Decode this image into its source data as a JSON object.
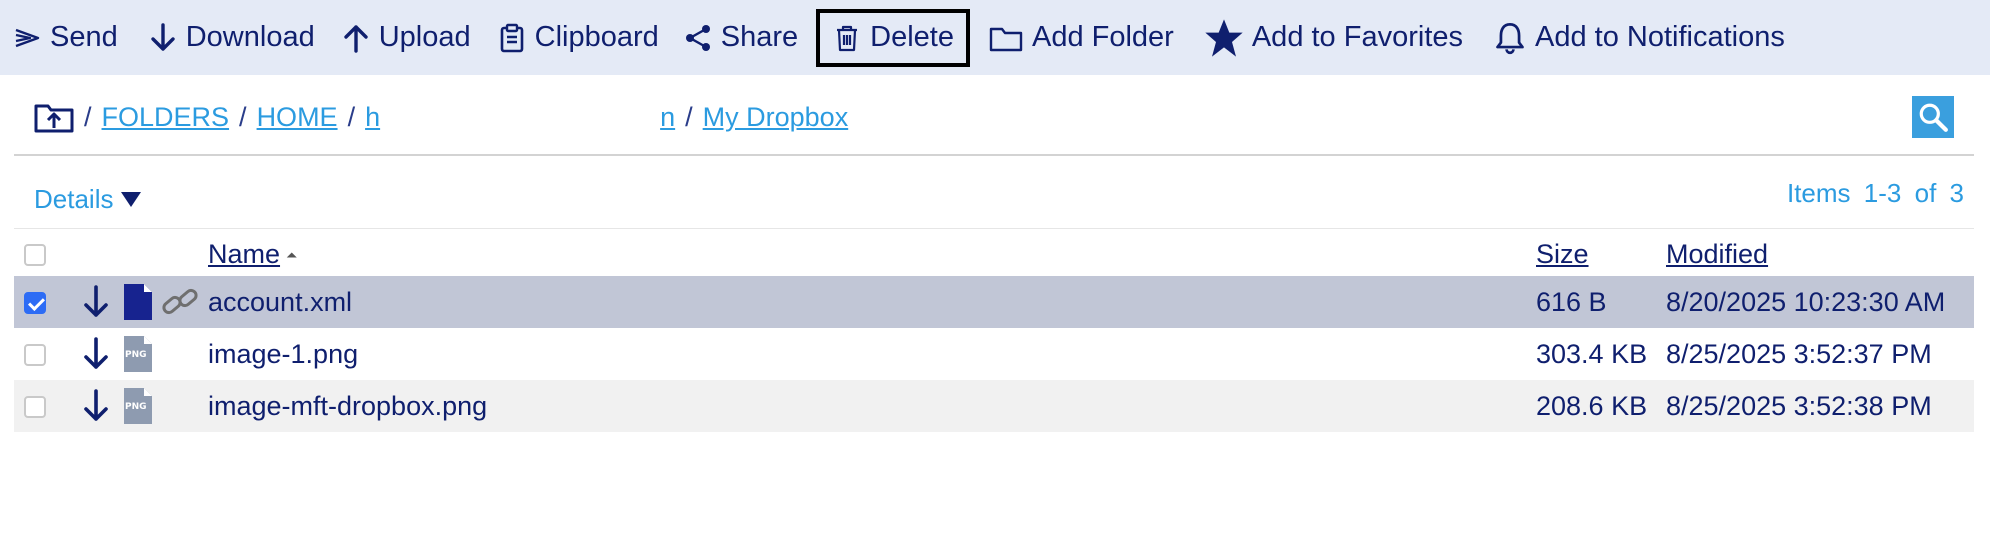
{
  "toolbar": {
    "send": "Send",
    "download": "Download",
    "upload": "Upload",
    "clipboard": "Clipboard",
    "share": "Share",
    "delete": "Delete",
    "add_folder": "Add Folder",
    "add_favorites": "Add to Favorites",
    "add_notifications": "Add to Notifications"
  },
  "breadcrumb": {
    "sep": "/",
    "items": [
      "FOLDERS",
      "HOME",
      "h",
      "n",
      "My Dropbox"
    ]
  },
  "view": {
    "details_label": "Details",
    "items_label": "Items",
    "items_range": "1-3",
    "items_of": "of",
    "items_total": "3"
  },
  "table": {
    "headers": {
      "name": "Name",
      "size": "Size",
      "modified": "Modified"
    },
    "rows": [
      {
        "name": "account.xml",
        "size": "616 B",
        "modified": "8/20/2025 10:23:30 AM",
        "checked": true,
        "icon": "xml-file-icon"
      },
      {
        "name": "image-1.png",
        "size": "303.4 KB",
        "modified": "8/25/2025 3:52:37 PM",
        "checked": false,
        "icon": "png-file-icon",
        "badge": "PNG"
      },
      {
        "name": "image-mft-dropbox.png",
        "size": "208.6 KB",
        "modified": "8/25/2025 3:52:38 PM",
        "checked": false,
        "icon": "png-file-icon",
        "badge": "PNG"
      }
    ]
  },
  "colors": {
    "accent": "#0f1f6e",
    "link": "#2b9be0",
    "toolbar_bg": "#e4eaf6",
    "selected_row": "#c1c6d6",
    "checkbox_checked": "#2d6cf5"
  }
}
